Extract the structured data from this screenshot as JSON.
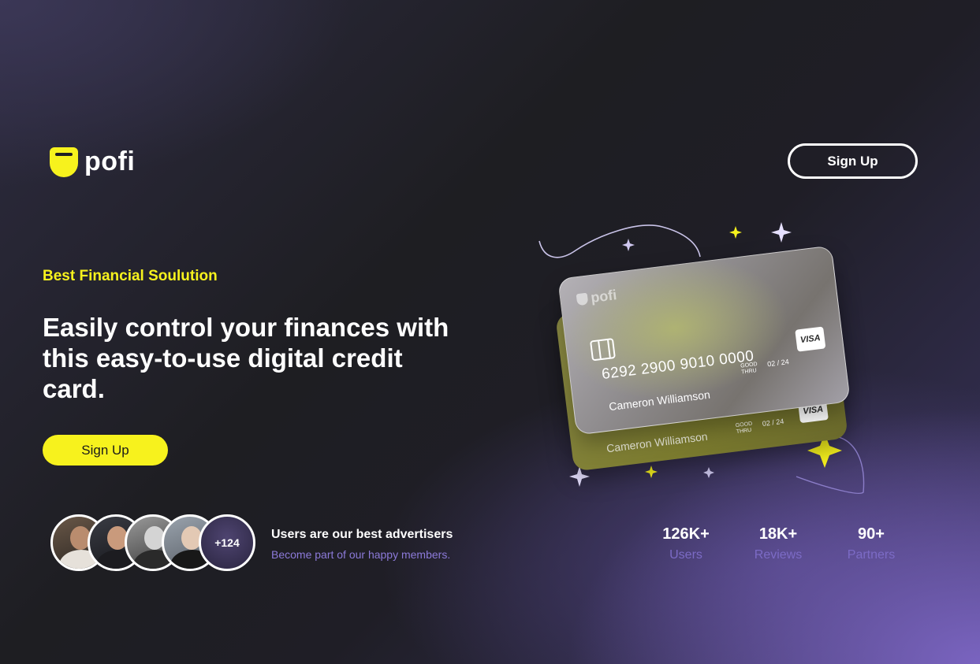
{
  "brand": {
    "name": "pofi"
  },
  "header": {
    "signup_label": "Sign Up"
  },
  "hero": {
    "tagline": "Best Financial Soulution",
    "headline": "Easily control your finances with this easy-to-use digital credit card.",
    "signup_label": "Sign Up"
  },
  "social": {
    "avatar_count": "+124",
    "title": "Users are our best advertisers",
    "subtitle": "Become part of our happy members."
  },
  "stats": [
    {
      "value": "126K+",
      "label": "Users"
    },
    {
      "value": "18K+",
      "label": "Reviews"
    },
    {
      "value": "90+",
      "label": "Partners"
    }
  ],
  "card": {
    "brand": "pofi",
    "number": "6292 2900 9010 0000",
    "holder": "Cameron Williamson",
    "good_thru_line1": "GOOD",
    "good_thru_line2": "THRU",
    "expiry": "02 / 24",
    "network": "VISA"
  },
  "colors": {
    "accent": "#f7f21d",
    "purple_text": "#8c7ad9",
    "background_dark": "#1e1e22"
  }
}
